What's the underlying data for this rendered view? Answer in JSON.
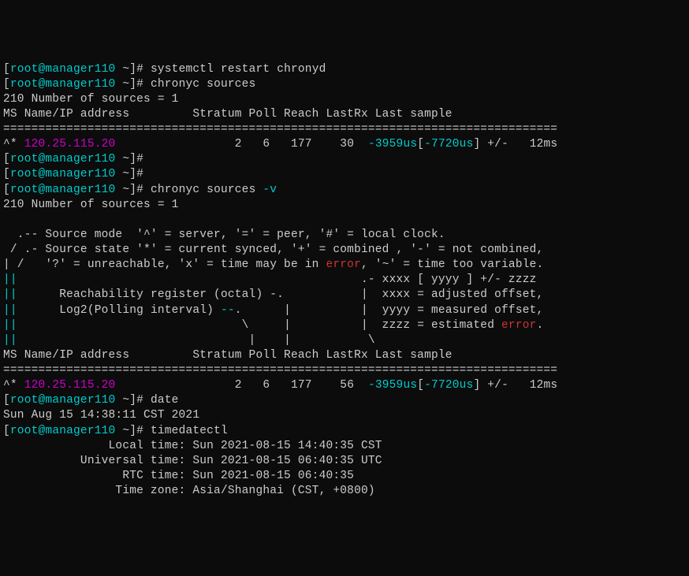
{
  "prompt": {
    "user": "root",
    "at": "@",
    "host": "manager110",
    "path": " ~",
    "hash": "#"
  },
  "cmds": {
    "restart": "systemctl restart chronyd",
    "sources": "chronyc sources",
    "sources_v": "chronyc sources ",
    "sources_v_opt": "-v",
    "date": "date",
    "timedatectl": "timedatectl"
  },
  "output": {
    "num_sources": "210 Number of sources = 1",
    "header": "MS Name/IP address         Stratum Poll Reach LastRx Last sample",
    "divider": "===============================================================================",
    "row1": {
      "prefix": "^* ",
      "ip": "120.25.115.20",
      "pad": "                 ",
      "stratum": "2",
      "poll": "   6",
      "reach": "   177",
      "lastrx": "    30",
      "offset_pre": "  ",
      "offset1": "-3959us",
      "bracket_open": "[",
      "offset2": "-7720us",
      "bracket_close": "]",
      "pm": " +/-   ",
      "err": "12ms"
    },
    "row2": {
      "prefix": "^* ",
      "ip": "120.25.115.20",
      "pad": "                 ",
      "stratum": "2",
      "poll": "   6",
      "reach": "   177",
      "lastrx": "    56",
      "offset_pre": "  ",
      "offset1": "-3959us",
      "bracket_open": "[",
      "offset2": "-7720us",
      "bracket_close": "]",
      "pm": " +/-   ",
      "err": "12ms"
    },
    "legend": {
      "l1": "  .-- Source mode  '^' = server, '=' = peer, '#' = local clock.",
      "l2": " / .- Source state '*' = current synced, '+' = combined , '-' = not combined,",
      "l3a": "| /   '?' = unreachable, 'x' = time may be in ",
      "l3_err": "error",
      "l3b": ", '~' = time too variable.",
      "l4a": "||                                                 .- xxxx [ yyyy ] +/- zzzz",
      "l5a": "||      Reachability register (octal) -.           |  xxxx = adjusted offset,",
      "l6a": "||      Log2(Polling interval) --.      |          |  yyyy = measured offset,",
      "l7a": "||                                \\     |          |  zzzz = estimated ",
      "l7_err": "error",
      "l7b": ".",
      "l8a": "||                                 |    |           \\"
    },
    "date_out": "Sun Aug 15 14:38:11 CST 2021",
    "tdc": {
      "l1": "               Local time: Sun 2021-08-15 14:40:35 CST",
      "l2": "           Universal time: Sun 2021-08-15 06:40:35 UTC",
      "l3": "                 RTC time: Sun 2021-08-15 06:40:35",
      "l4": "                Time zone: Asia/Shanghai (CST, +0800)"
    }
  }
}
